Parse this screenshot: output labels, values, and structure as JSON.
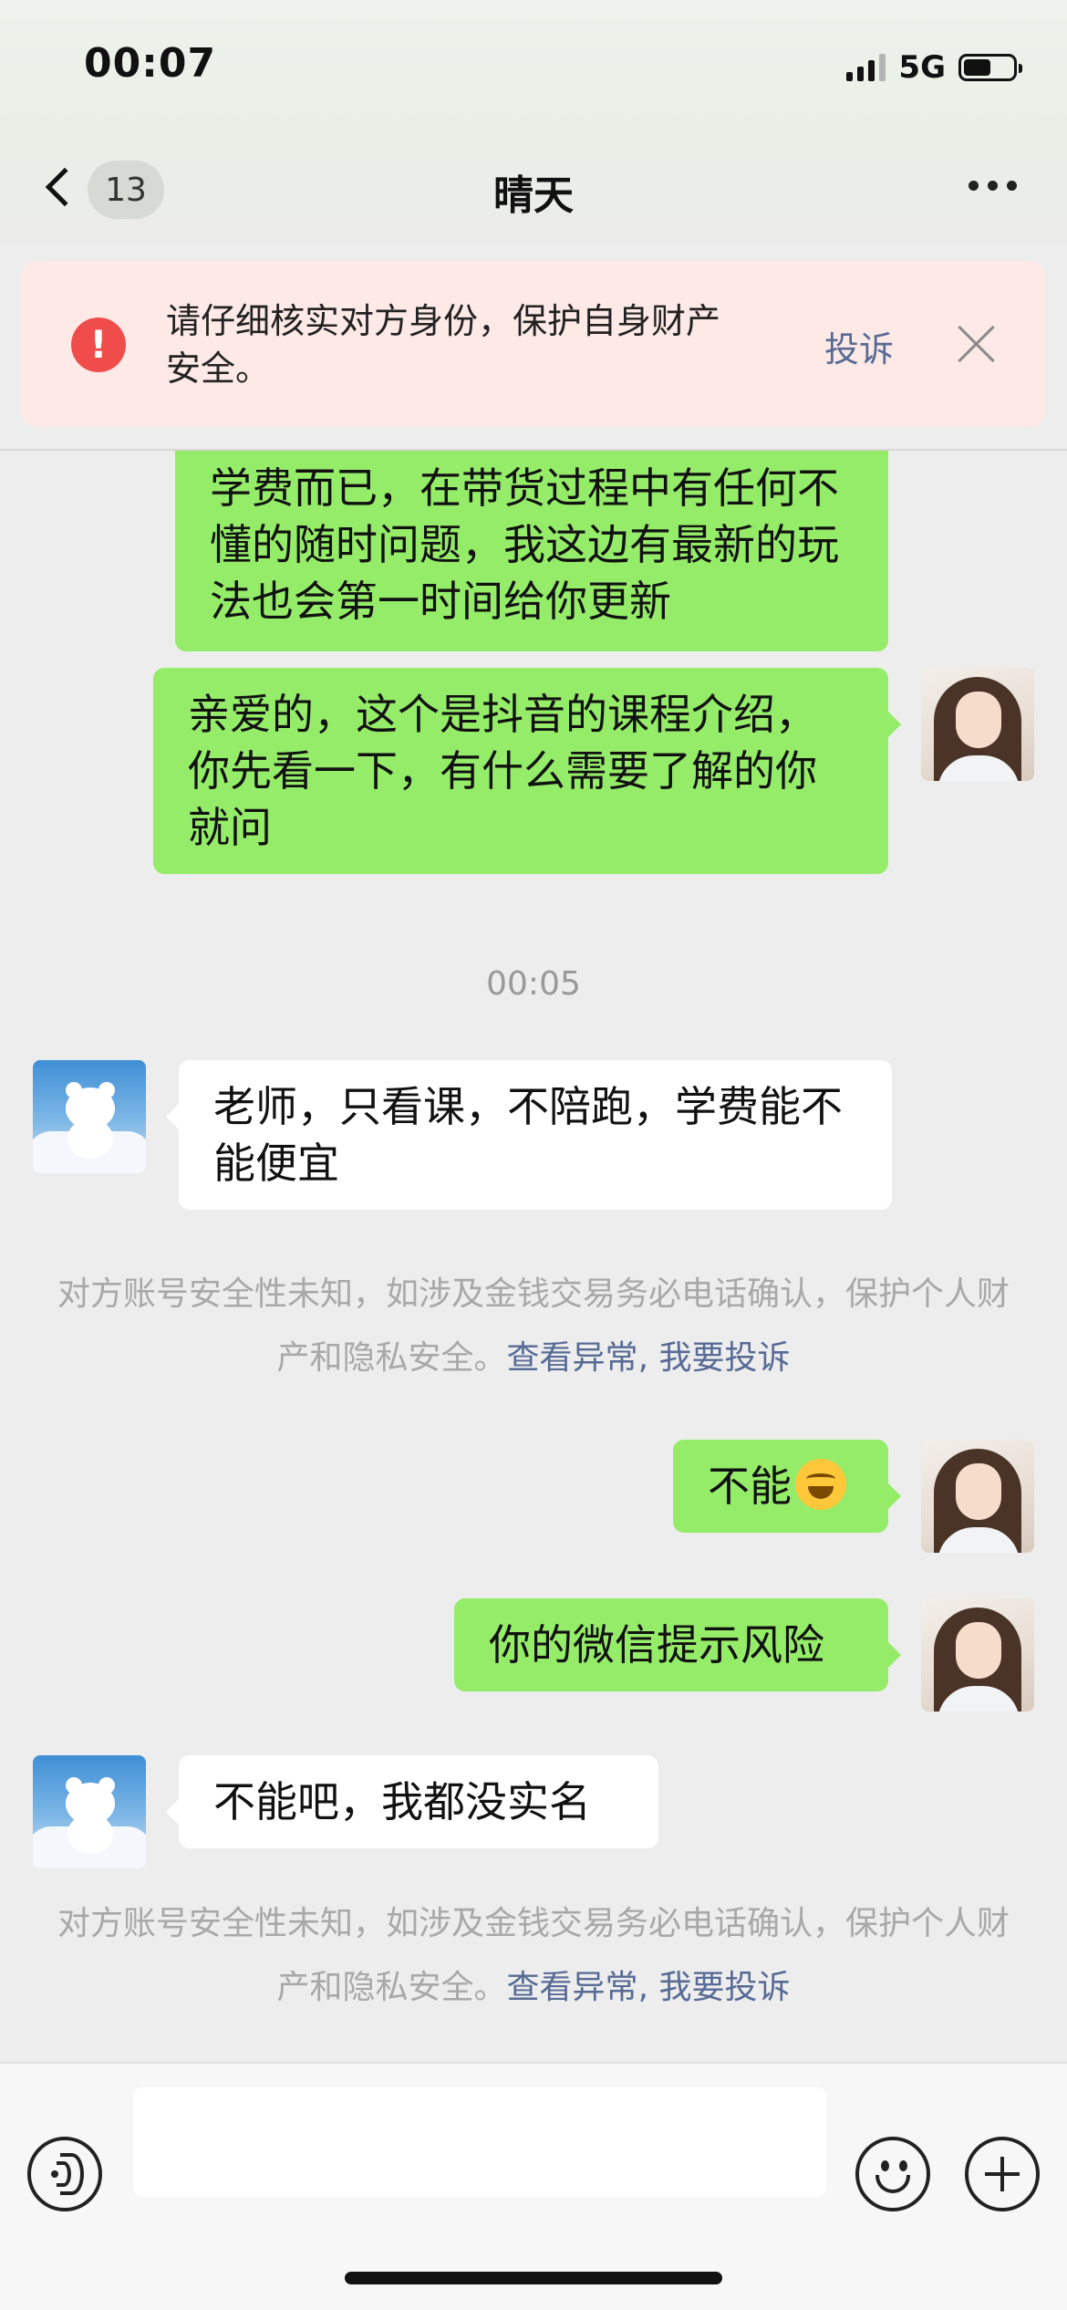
{
  "status_bar": {
    "time": "00:07",
    "network": "5G"
  },
  "header": {
    "unread_count": "13",
    "title": "晴天"
  },
  "warning": {
    "text": "请仔细核实对方身份，保护自身财产安全。",
    "report_label": "投诉"
  },
  "messages": {
    "m0": {
      "from": "me",
      "text": "学费而已，在带货过程中有任何不懂的随时问题，我这边有最新的玩法也会第一时间给你更新"
    },
    "m1": {
      "from": "me",
      "text": "亲爱的，这个是抖音的课程介绍，你先看一下，有什么需要了解的你就问"
    },
    "timestamp": "00:05",
    "m2": {
      "from": "other",
      "text": "老师，只看课，不陪跑，学费能不能便宜"
    },
    "notice1": {
      "text": "对方账号安全性未知，如涉及金钱交易务必电话确认，保护个人财产和隐私安全。",
      "link1": "查看异常",
      "sep": ", ",
      "link2": "我要投诉"
    },
    "m3": {
      "from": "me",
      "text": "不能",
      "emoji": "crying-laughing-face"
    },
    "m4": {
      "from": "me",
      "text": "你的微信提示风险"
    },
    "m5": {
      "from": "other",
      "text": "不能吧，我都没实名"
    },
    "notice2": {
      "text": "对方账号安全性未知，如涉及金钱交易务必电话确认，保护个人财产和隐私安全。",
      "link1": "查看异常",
      "sep": ", ",
      "link2": "我要投诉"
    }
  },
  "input_bar": {
    "value": ""
  },
  "colors": {
    "outgoing_bubble": "#95ec69",
    "incoming_bubble": "#ffffff",
    "link": "#576b95",
    "warning_bg": "#fde9e6",
    "warning_icon": "#f04c4c"
  }
}
